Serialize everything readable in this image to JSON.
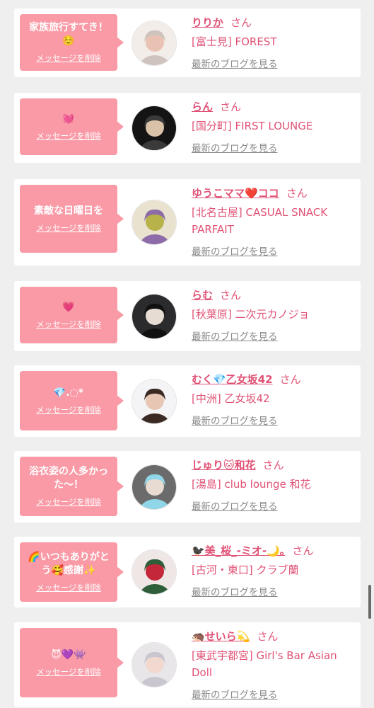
{
  "cards": [
    {
      "message": "家族旅行すてき！☺️",
      "delete_label": "メッセージを削除",
      "name": "りりか",
      "san": "さん",
      "shop": "[富士見] FOREST",
      "blog_link": "最新のブログを見る",
      "avatar_icon": "avatar-photo",
      "colors": {
        "bg": "#f2ede8",
        "a": "#e9c2b3",
        "b": "#cfc4bd"
      }
    },
    {
      "message": "💓",
      "delete_label": "メッセージを削除",
      "name": "らん",
      "san": "さん",
      "shop": "[国分町] FIRST LOUNGE",
      "blog_link": "最新のブログを見る",
      "avatar_icon": "avatar-photo",
      "colors": {
        "bg": "#141414",
        "a": "#d9c2a8",
        "b": "#3a3a3a"
      }
    },
    {
      "message": "素敵な日曜日を",
      "delete_label": "メッセージを削除",
      "name": "ゆうこママ❤️ココ",
      "san": "さん",
      "shop": "[北名古屋] CASUAL SNACK PARFAIT",
      "blog_link": "最新のブログを見る",
      "avatar_icon": "avatar-photo",
      "colors": {
        "bg": "#e8e2cf",
        "a": "#b7b24a",
        "b": "#8d6aa8"
      }
    },
    {
      "message": "💗",
      "delete_label": "メッセージを削除",
      "name": "らむ",
      "san": "さん",
      "shop": "[秋葉原] 二次元カノジョ",
      "blog_link": "最新のブログを見る",
      "avatar_icon": "avatar-photo",
      "colors": {
        "bg": "#2b2b2e",
        "a": "#e6dcd4",
        "b": "#111111"
      }
    },
    {
      "message": "💎.◌*",
      "delete_label": "メッセージを削除",
      "name": "むく💎乙女坂42",
      "san": "さん",
      "shop": "[中洲] 乙女坂42",
      "blog_link": "最新のブログを見る",
      "avatar_icon": "avatar-photo",
      "colors": {
        "bg": "#f4f4f6",
        "a": "#e7c6b4",
        "b": "#3b2a24"
      }
    },
    {
      "message": "浴衣姿の人多かった〜！",
      "delete_label": "メッセージを削除",
      "name": "じゅり🐱和花",
      "san": "さん",
      "shop": "[湯島] club lounge 和花",
      "blog_link": "最新のブログを見る",
      "avatar_icon": "avatar-photo",
      "colors": {
        "bg": "#6b6b6b",
        "a": "#e8dcd2",
        "b": "#8fd6e8"
      }
    },
    {
      "message": "🌈いつもありがとう🥰感謝✨",
      "delete_label": "メッセージを削除",
      "name": "🐦‍⬛美_桜_-ミオ-🌙｡",
      "san": "さん",
      "shop": "[古河・東口] クラブ蘭",
      "blog_link": "最新のブログを見る",
      "avatar_icon": "avatar-photo",
      "colors": {
        "bg": "#efe6e6",
        "a": "#c4263a",
        "b": "#2f5e3a"
      }
    },
    {
      "message": "😈💜👾",
      "delete_label": "メッセージを削除",
      "name": "🦔せいら💫",
      "san": "さん",
      "shop": "[東武宇都宮] Girl's Bar Asian Doll",
      "blog_link": "最新のブログを見る",
      "avatar_icon": "avatar-photo",
      "colors": {
        "bg": "#e9e6ea",
        "a": "#f1d9cf",
        "b": "#c9c6d0"
      }
    }
  ]
}
